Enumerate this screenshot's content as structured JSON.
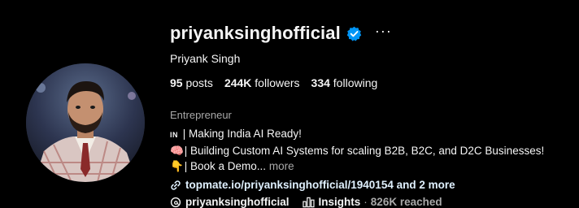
{
  "profile": {
    "username": "priyanksinghofficial",
    "full_name": "Priyank Singh",
    "verified_icon": "verified-badge-icon",
    "options_glyph": "···",
    "stats": {
      "posts_count": "95",
      "posts_label": "posts",
      "followers_count": "244K",
      "followers_label": "followers",
      "following_count": "334",
      "following_label": "following"
    },
    "category": "Entrepreneur",
    "bio": {
      "line1_flag": "IN",
      "line1_text": " | Making India AI Ready!",
      "line2_emoji": "🧠",
      "line2_text": " | Building Custom AI Systems for scaling B2B, B2C, and D2C Businesses!",
      "line3_emoji": "👇",
      "line3_text": " | Book a Demo...",
      "more_label": "more"
    },
    "link": {
      "icon": "link-icon",
      "text": "topmate.io/priyanksinghofficial/1940154 and 2 more"
    },
    "threads": {
      "icon": "threads-icon",
      "handle": "priyanksinghofficial"
    },
    "insights": {
      "icon": "bar-chart-icon",
      "label": "Insights",
      "separator": "·",
      "reached": "826K reached"
    }
  },
  "colors": {
    "background": "#000000",
    "text": "#f5f5f5",
    "secondary": "#a8a8a8",
    "verified": "#0095f6",
    "link": "#e0f1ff"
  }
}
